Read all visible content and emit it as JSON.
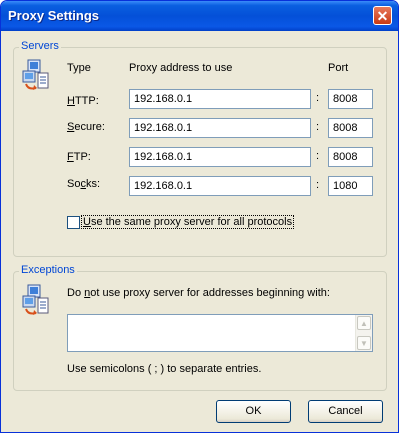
{
  "window": {
    "title": "Proxy Settings",
    "close_glyph": "✕"
  },
  "servers": {
    "group_label": "Servers",
    "headers": {
      "type": "Type",
      "address": "Proxy address to use",
      "port": "Port"
    },
    "rows": [
      {
        "label_mnemonic": "H",
        "label_rest": "TTP:",
        "address": "192.168.0.1",
        "port": "8008"
      },
      {
        "label_mnemonic": "S",
        "label_rest": "ecure:",
        "address": "192.168.0.1",
        "port": "8008"
      },
      {
        "label_mnemonic": "F",
        "label_rest": "TP:",
        "address": "192.168.0.1",
        "port": "8008"
      },
      {
        "label_pre": "So",
        "label_mnemonic": "c",
        "label_rest": "ks:",
        "address": "192.168.0.1",
        "port": "1080"
      }
    ],
    "colon": ":",
    "same_proxy_label_mnemonic": "U",
    "same_proxy_label_rest": "se the same proxy server for all protocols",
    "same_proxy_checked": false
  },
  "exceptions": {
    "group_label": "Exceptions",
    "prompt_pre": "Do ",
    "prompt_mnemonic": "n",
    "prompt_rest": "ot use proxy server for addresses beginning with:",
    "value": "",
    "hint": "Use semicolons ( ; ) to separate entries."
  },
  "buttons": {
    "ok": "OK",
    "cancel": "Cancel"
  },
  "icons": {
    "servers": "network-computer-icon",
    "exceptions": "network-computer-icon"
  }
}
